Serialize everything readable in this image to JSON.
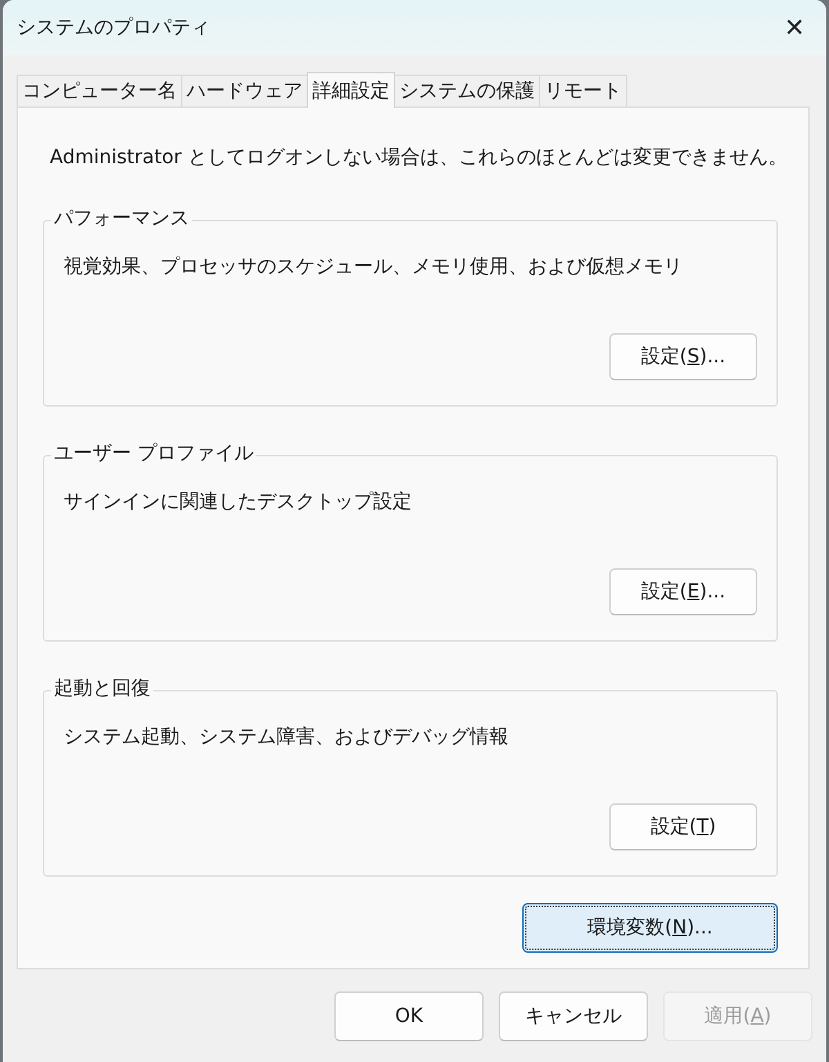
{
  "window": {
    "title": "システムのプロパティ",
    "close": "✕"
  },
  "tabs": [
    {
      "label": "コンピューター名",
      "selected": false
    },
    {
      "label": "ハードウェア",
      "selected": false
    },
    {
      "label": "詳細設定",
      "selected": true
    },
    {
      "label": "システムの保護",
      "selected": false
    },
    {
      "label": "リモート",
      "selected": false
    }
  ],
  "notice": "Administrator としてログオンしない場合は、これらのほとんどは変更できません。",
  "groups": [
    {
      "title": "パフォーマンス",
      "description": "視覚効果、プロセッサのスケジュール、メモリ使用、および仮想メモリ",
      "button": [
        "設定(",
        "S",
        ")..."
      ]
    },
    {
      "title": "ユーザー プロファイル",
      "description": "サインインに関連したデスクトップ設定",
      "button": [
        "設定(",
        "E",
        ")..."
      ]
    },
    {
      "title": "起動と回復",
      "description": "システム起動、システム障害、およびデバッグ情報",
      "button": [
        "設定(",
        "T",
        ")"
      ]
    }
  ],
  "env_button": {
    "label": [
      "環境変数(",
      "N",
      ")..."
    ],
    "focused": true
  },
  "footer_buttons": [
    {
      "label": [
        "OK"
      ],
      "disabled": false
    },
    {
      "label": [
        "キャンセル"
      ],
      "disabled": false
    },
    {
      "label": [
        "適用(",
        "A",
        ")"
      ],
      "disabled": true
    }
  ]
}
